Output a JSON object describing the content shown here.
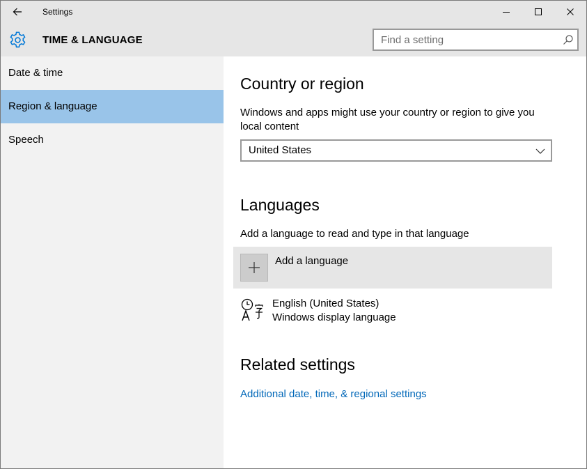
{
  "window": {
    "title": "Settings"
  },
  "header": {
    "section_title": "TIME & LANGUAGE",
    "search_placeholder": "Find a setting"
  },
  "sidebar": {
    "items": [
      {
        "label": "Date & time",
        "selected": false
      },
      {
        "label": "Region & language",
        "selected": true
      },
      {
        "label": "Speech",
        "selected": false
      }
    ]
  },
  "content": {
    "country": {
      "heading": "Country or region",
      "description_line1": "Windows and apps might use your country or region to give you",
      "description_line2": "local content",
      "selected": "United States"
    },
    "languages": {
      "heading": "Languages",
      "description": "Add a language to read and type in that language",
      "add_label": "Add a language",
      "items": [
        {
          "name": "English (United States)",
          "sub": "Windows display language"
        }
      ]
    },
    "related": {
      "heading": "Related settings",
      "link": "Additional date, time, & regional settings"
    }
  },
  "colors": {
    "accent": "#0078d7",
    "link": "#0067b8",
    "selection": "#99c4e9",
    "sidebar_bg": "#f2f2f2",
    "header_bg": "#e6e6e6"
  },
  "icons": {
    "back": "back-arrow-icon",
    "minimize": "minimize-icon",
    "maximize": "maximize-icon",
    "close": "close-icon",
    "section": "gear-icon",
    "search": "search-icon",
    "dropdown": "chevron-down-icon",
    "add": "plus-icon",
    "language": "language-icon"
  }
}
